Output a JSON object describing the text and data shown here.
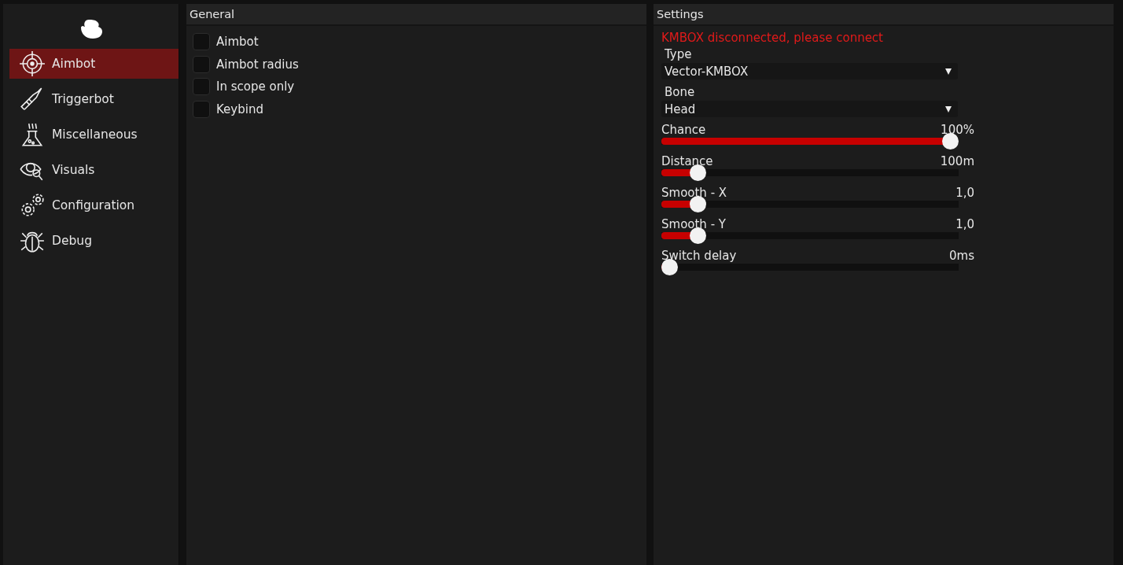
{
  "sidebar": {
    "items": [
      {
        "label": "Aimbot",
        "selected": true
      },
      {
        "label": "Triggerbot",
        "selected": false
      },
      {
        "label": "Miscellaneous",
        "selected": false
      },
      {
        "label": "Visuals",
        "selected": false
      },
      {
        "label": "Configuration",
        "selected": false
      },
      {
        "label": "Debug",
        "selected": false
      }
    ]
  },
  "general": {
    "title": "General",
    "checkboxes": [
      {
        "label": "Aimbot",
        "checked": false
      },
      {
        "label": "Aimbot radius",
        "checked": false
      },
      {
        "label": "In scope only",
        "checked": false
      },
      {
        "label": "Keybind",
        "checked": false
      }
    ]
  },
  "settings": {
    "title": "Settings",
    "status": "KMBOX disconnected, please connect",
    "controls": [
      {
        "kind": "dropdown",
        "label": "Type",
        "value": "Vector-KMBOX"
      },
      {
        "kind": "dropdown",
        "label": "Bone",
        "value": "Head"
      },
      {
        "kind": "slider",
        "label": "Chance",
        "reading": "100%",
        "level": 1
      },
      {
        "kind": "slider",
        "label": "Distance",
        "reading": "100m",
        "level": 0.1
      },
      {
        "kind": "slider",
        "label": "Smooth - X",
        "reading": "1,0",
        "level": 0.1
      },
      {
        "kind": "slider",
        "label": "Smooth - Y",
        "reading": "1,0",
        "level": 0.1
      },
      {
        "kind": "slider",
        "label": "Switch delay",
        "reading": "0ms",
        "level": 0
      }
    ]
  }
}
